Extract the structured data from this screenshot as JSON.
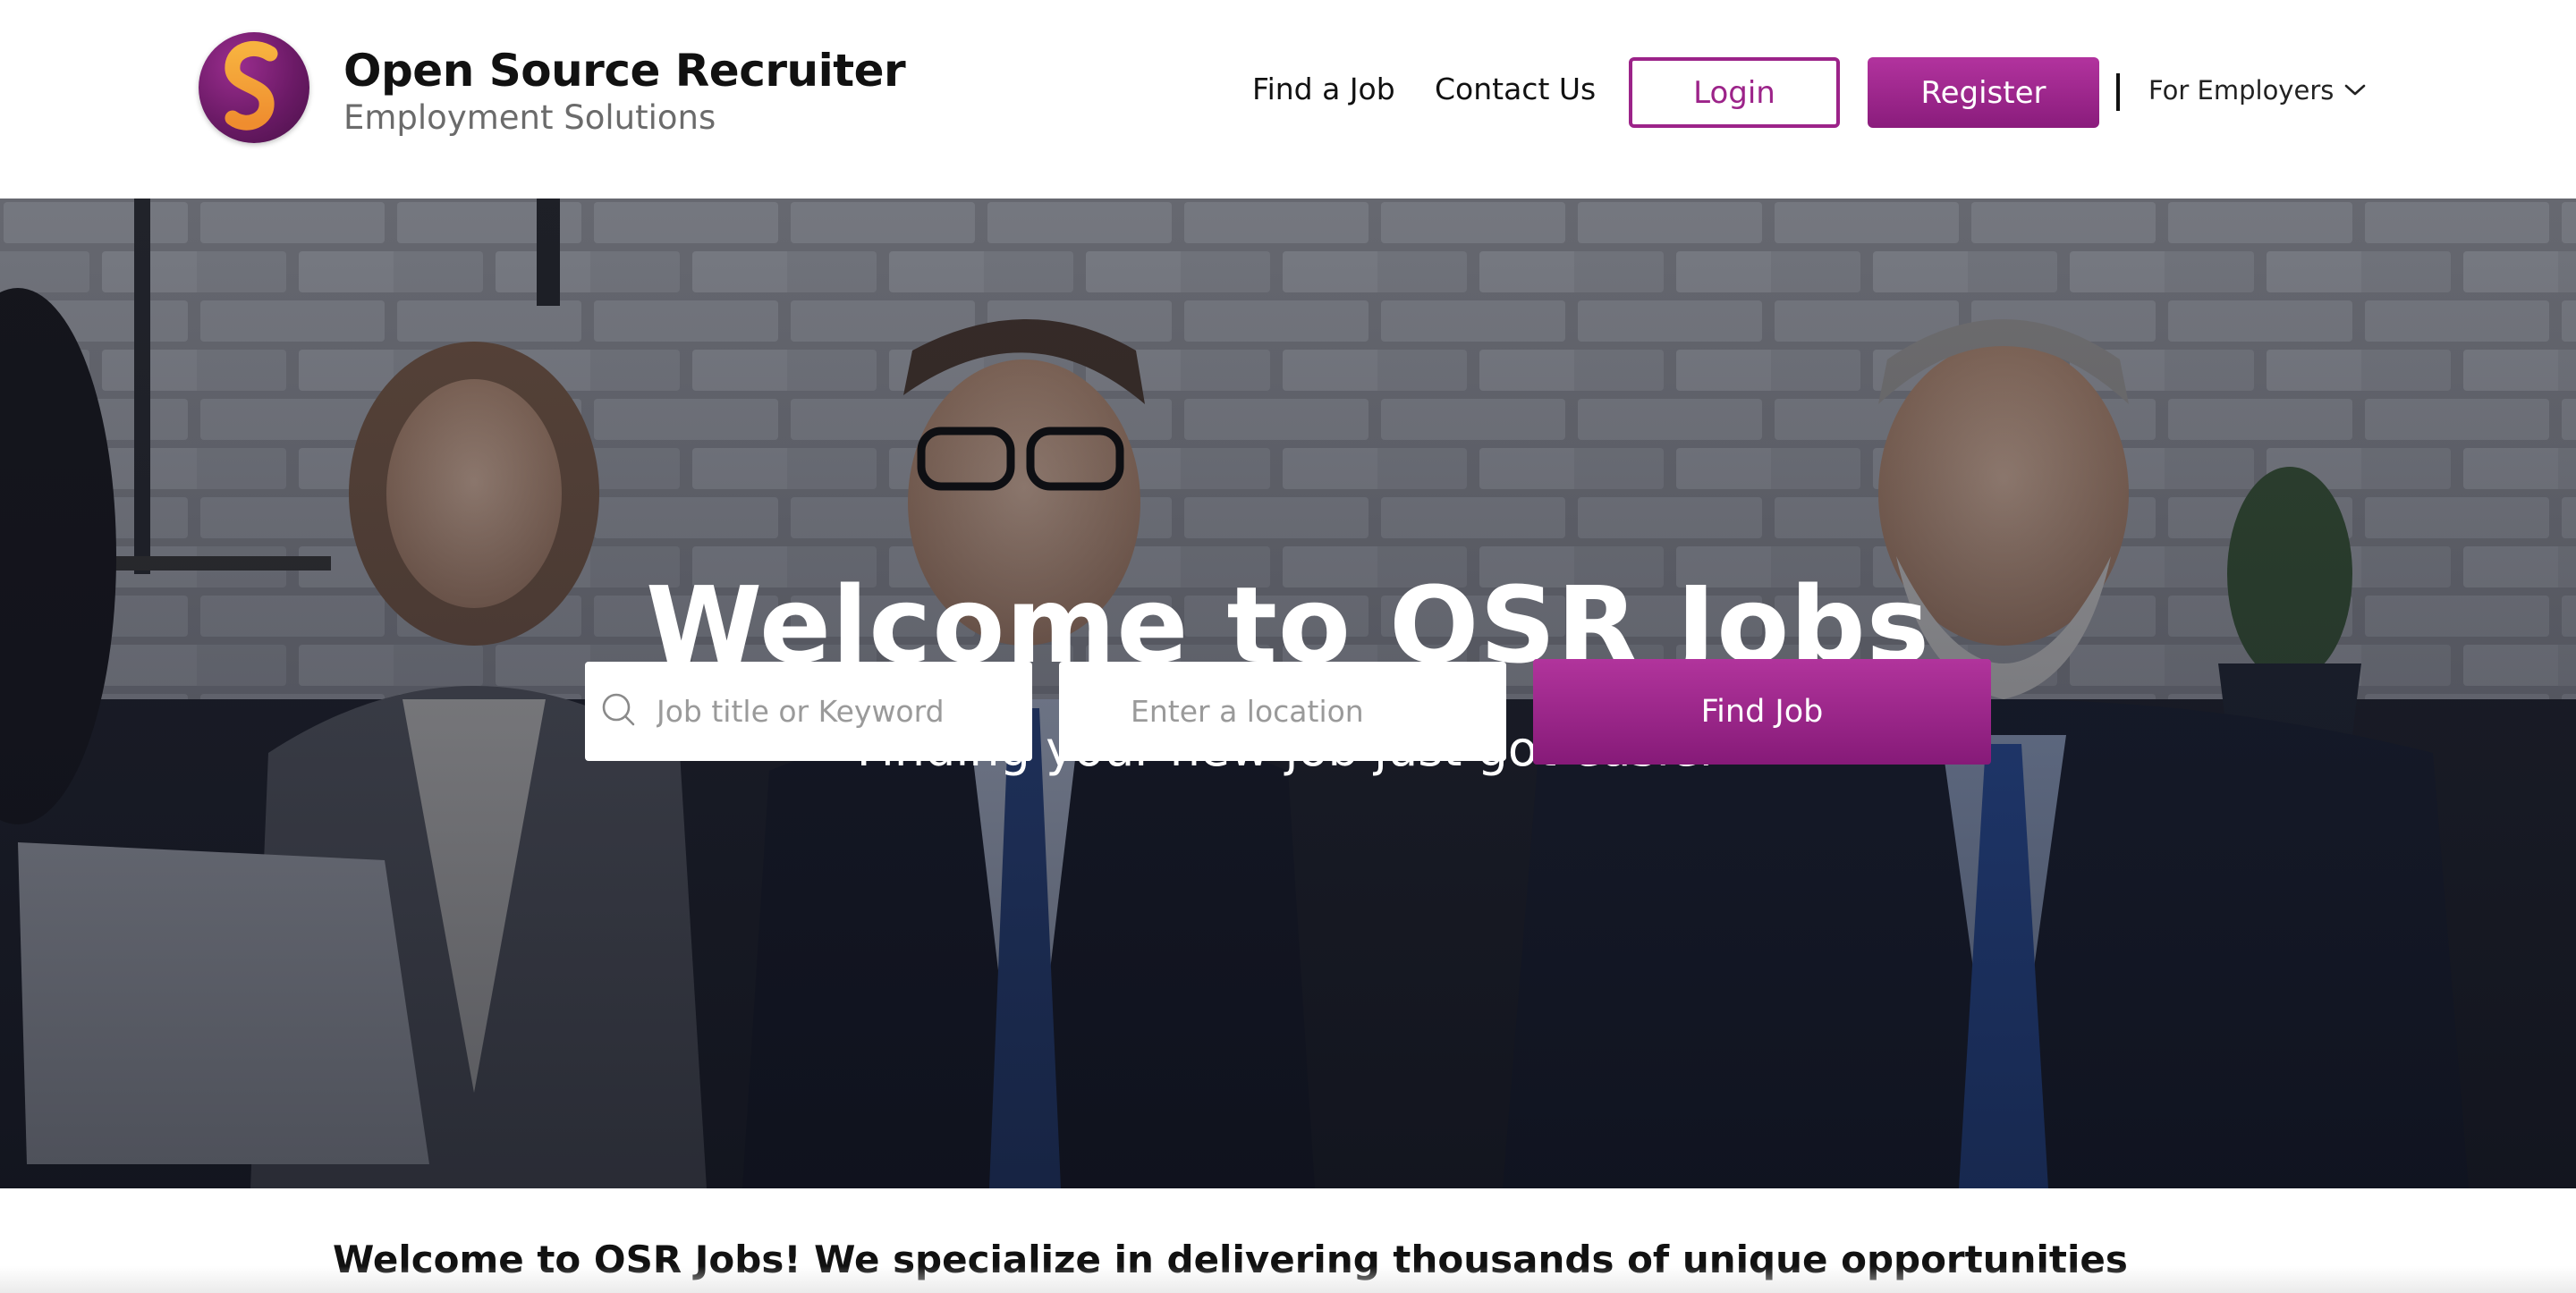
{
  "header": {
    "brand_title": "Open Source Recruiter",
    "brand_subtitle": "Employment Solutions",
    "logo_icon": "s-monogram-logo",
    "nav": {
      "find_job": "Find a Job",
      "contact": "Contact Us",
      "login": "Login",
      "register": "Register",
      "employers": "For Employers"
    }
  },
  "hero": {
    "title": "Welcome to OSR Jobs",
    "subtitle": "Finding your new job just got easier",
    "search": {
      "keyword_placeholder": "Job title or Keyword",
      "location_placeholder": "Enter a location",
      "find_label": "Find Job"
    }
  },
  "intro": {
    "text": "Welcome to OSR Jobs! We specialize in delivering thousands of unique opportunities nationwide, with new"
  },
  "colors": {
    "accent": "#9c2389",
    "accent_dark": "#861a78",
    "logo_gold": "#f4a93b",
    "text": "#111111",
    "muted": "#6b6b6b"
  }
}
